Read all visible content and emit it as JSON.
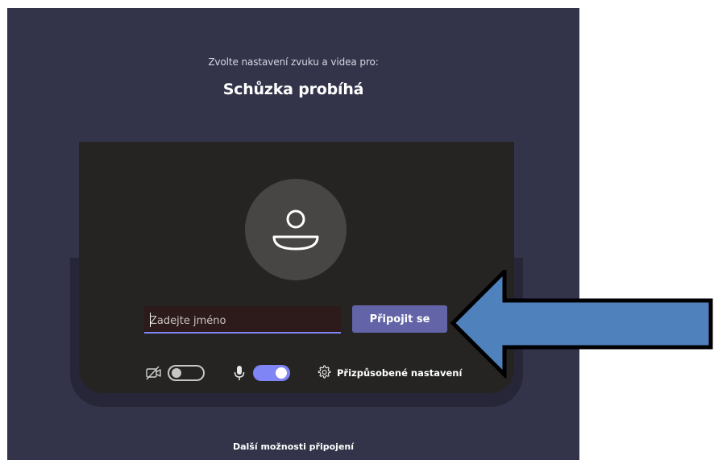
{
  "prejoin": {
    "subtitle": "Zvolte nastavení zvuku a videa pro:",
    "meeting_title": "Schůzka probíhá"
  },
  "name_input": {
    "placeholder": "Zadejte jméno",
    "value": ""
  },
  "join_button": {
    "label": "Připojit se"
  },
  "controls": {
    "camera_toggle": {
      "state": "off",
      "icon": "camera-off-icon"
    },
    "mic_toggle": {
      "state": "on",
      "icon": "microphone-icon"
    },
    "custom_settings": {
      "label": "Přizpůsobené nastavení",
      "icon": "gear-icon"
    }
  },
  "footer": {
    "more_options": "Další možnosti připojení"
  },
  "annotation": {
    "arrow_color": "#4f81bd",
    "arrow_direction": "left"
  },
  "colors": {
    "background": "#33344a",
    "panel": "#252423",
    "accent": "#6264a7",
    "toggle_on": "#7f85f5"
  }
}
